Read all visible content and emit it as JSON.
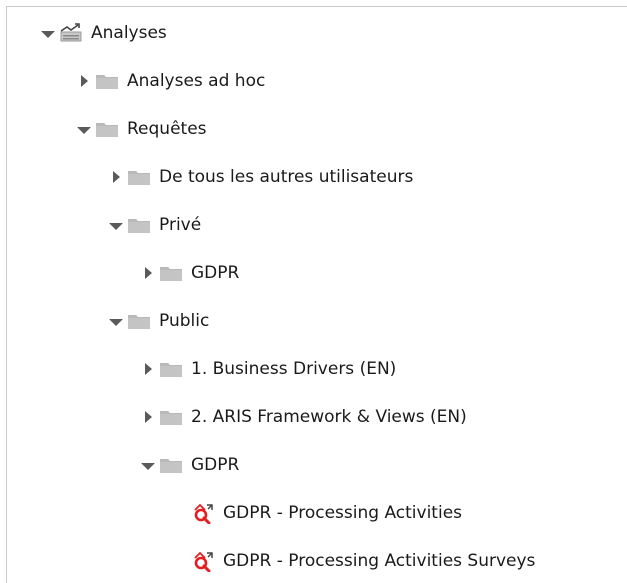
{
  "tree": {
    "root": {
      "label": "Analyses",
      "icon": "analyses-icon",
      "expanded": true
    },
    "ad_hoc": {
      "label": "Analyses ad hoc",
      "icon": "folder-icon",
      "expanded": false
    },
    "queries": {
      "label": "Requêtes",
      "icon": "folder-icon",
      "expanded": true
    },
    "others": {
      "label": "De tous les autres utilisateurs",
      "icon": "folder-icon",
      "expanded": false
    },
    "private": {
      "label": "Privé",
      "icon": "folder-icon",
      "expanded": true
    },
    "private_gdpr": {
      "label": "GDPR",
      "icon": "folder-icon",
      "expanded": false
    },
    "public": {
      "label": "Public",
      "icon": "folder-icon",
      "expanded": true
    },
    "business": {
      "label": "1. Business Drivers (EN)",
      "icon": "folder-icon",
      "expanded": false
    },
    "aris": {
      "label": "2. ARIS Framework & Views (EN)",
      "icon": "folder-icon",
      "expanded": false
    },
    "public_gdpr": {
      "label": "GDPR",
      "icon": "folder-icon",
      "expanded": true
    },
    "query1": {
      "label": "GDPR - Processing Activities",
      "icon": "query-icon"
    },
    "query2": {
      "label": "GDPR - Processing Activities Surveys",
      "icon": "query-icon"
    }
  },
  "colors": {
    "folder": "#b9b9b9",
    "query_red": "#e02020",
    "twisty": "#5a5a5a",
    "border": "#c9c9c9"
  }
}
